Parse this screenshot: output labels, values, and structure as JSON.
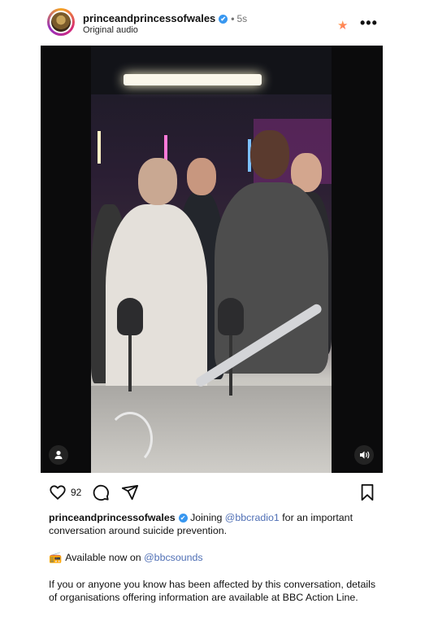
{
  "post": {
    "username": "princeandprincessofwales",
    "dot": "•",
    "time": "5s",
    "subtitle": "Original audio"
  },
  "icons": {
    "verified": "✔",
    "star": "★",
    "more": "•••",
    "user": "user-icon",
    "sound": "sound-icon",
    "heart": "heart-icon",
    "comment": "comment-icon",
    "share": "share-icon",
    "save": "bookmark-icon",
    "radio": "📻"
  },
  "actions": {
    "likes": "92"
  },
  "caption": {
    "username": "princeandprincessofwales",
    "text1": " Joining ",
    "mention1": "@bbcradio1",
    "text2": " for an important conversation around suicide prevention."
  },
  "available": {
    "text": "Available now on ",
    "mention": "@bbcsounds"
  },
  "info": {
    "text": "If you or anyone you know has been affected by this conversation, details of organisations offering information are available at BBC Action Line."
  },
  "colors": {
    "verified": "#3897f0",
    "mention": "#4f6fb5"
  }
}
